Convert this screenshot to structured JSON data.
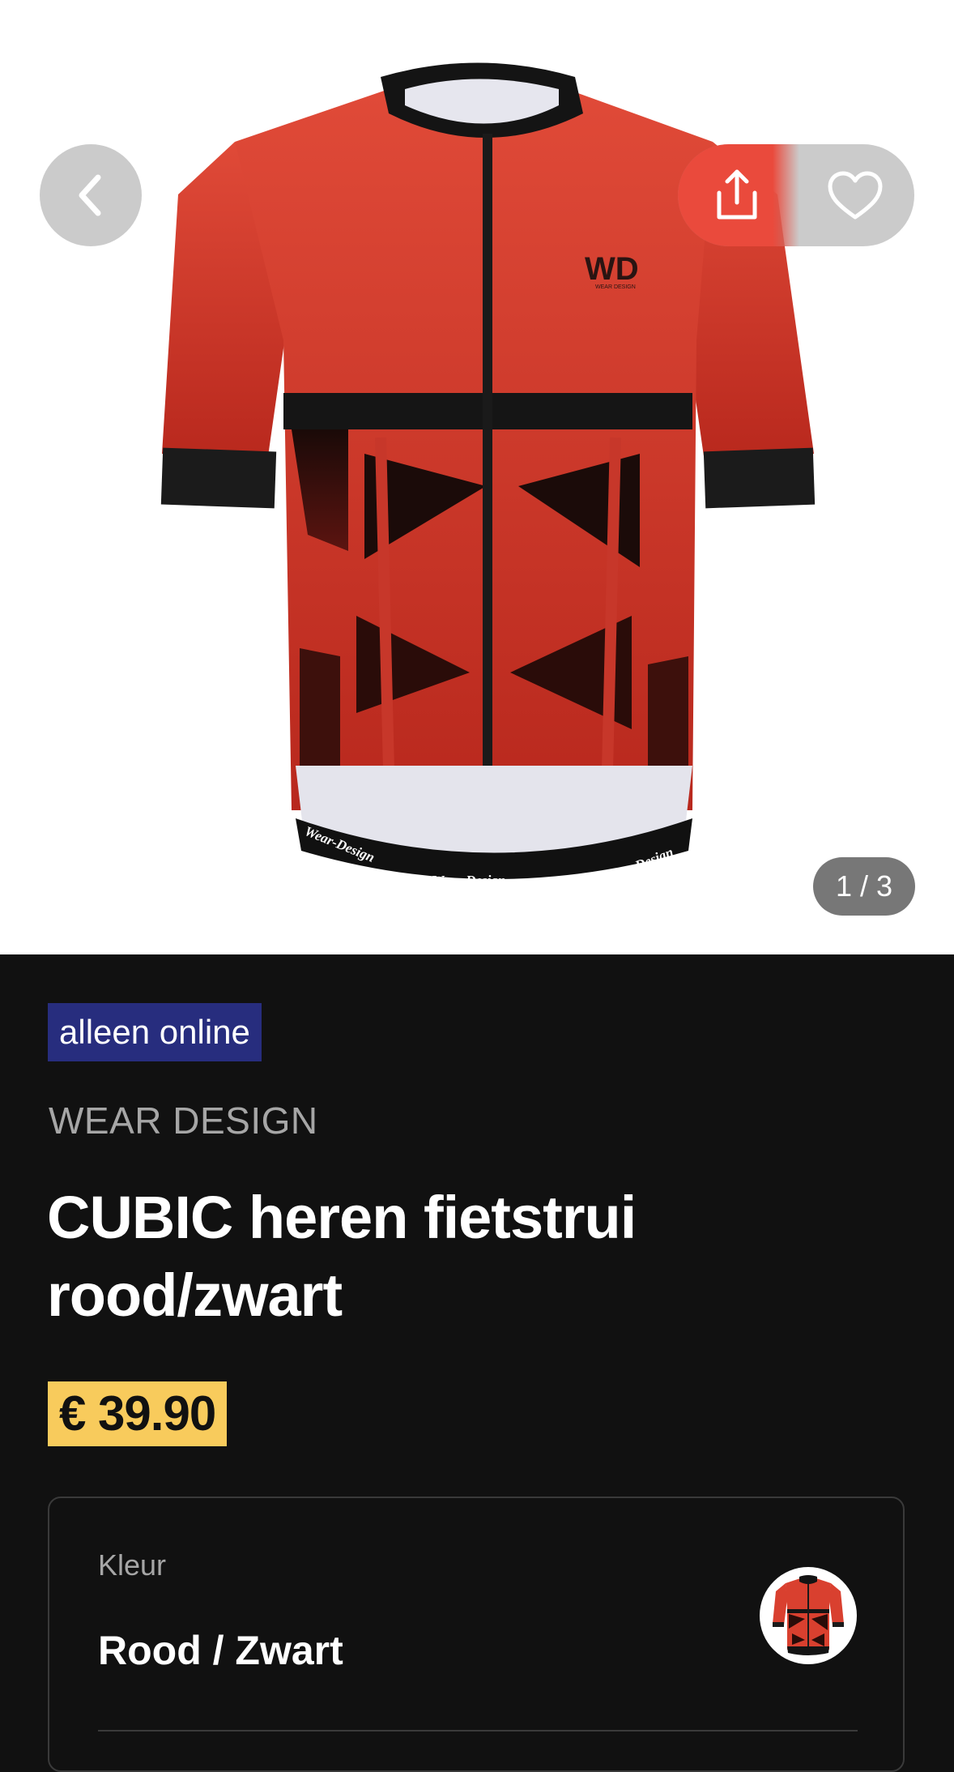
{
  "gallery": {
    "counter": "1 / 3",
    "jersey_print_text": [
      "Wear-Design",
      "Wear-Design",
      "Wear-Design"
    ],
    "logo_text": "WD",
    "logo_subtext": "WEAR DESIGN"
  },
  "icons": {
    "back": "chevron-left-icon",
    "share": "share-icon",
    "favorite": "heart-icon"
  },
  "product": {
    "badge": "alleen online",
    "brand": "WEAR DESIGN",
    "title": "CUBIC heren fietstrui rood/zwart",
    "price": "€ 39.90"
  },
  "color_selector": {
    "label": "Kleur",
    "value": "Rood / Zwart"
  },
  "colors": {
    "background": "#111111",
    "badge_bg": "#272d7e",
    "price_bg": "#f8cb5c",
    "share_accent": "#ea4a3c",
    "jersey_red": "#d9402f"
  }
}
